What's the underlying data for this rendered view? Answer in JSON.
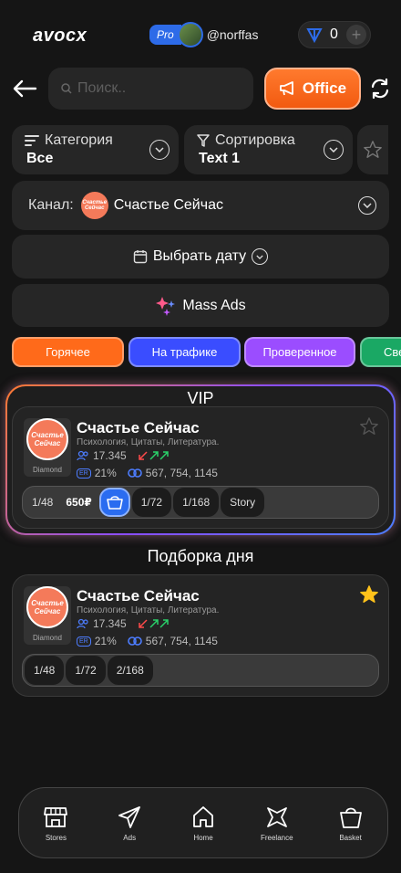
{
  "header": {
    "logo": "avocx",
    "pro_badge": "Pro",
    "username": "@norffas",
    "wallet_value": "0"
  },
  "search": {
    "placeholder": "Поиск.."
  },
  "office_label": "Office",
  "filters": {
    "category_label": "Категория",
    "category_value": "Все",
    "sort_label": "Сортировка",
    "sort_value": "Text 1"
  },
  "channel": {
    "label": "Канал:",
    "name": "Счастье Сейчас",
    "avatar_text": "Счастье Сейчас"
  },
  "date_button": "Выбрать дату",
  "mass_ads": "Mass Ads",
  "pills": [
    {
      "label": "Горячее",
      "color": "#ff6a1a"
    },
    {
      "label": "На трафике",
      "color": "#3a4dff"
    },
    {
      "label": "Проверенное",
      "color": "#9b4dff"
    },
    {
      "label": "Све",
      "color": "#1aa864"
    }
  ],
  "vip": {
    "title": "VIP",
    "card": {
      "name": "Счастье Сейчас",
      "tags": "Психология, Цитаты, Литература.",
      "subscribers": "17.345",
      "er": "21%",
      "reach": "567, 754, 1145",
      "badge": "Diamond",
      "avatar_text": "Счастье Сейчас",
      "slots": [
        "1/48",
        "650₽",
        "1/72",
        "1/168",
        "Story"
      ]
    }
  },
  "daily": {
    "title": "Подборка дня",
    "card": {
      "name": "Счастье Сейчас",
      "tags": "Психология, Цитаты, Литература.",
      "subscribers": "17.345",
      "er": "21%",
      "reach": "567, 754, 1145",
      "badge": "Diamond",
      "avatar_text": "Счастье Сейчас",
      "slots": [
        "1/48",
        "1/72",
        "2/168"
      ]
    }
  },
  "nav": {
    "stores": "Stores",
    "ads": "Ads",
    "home": "Home",
    "freelance": "Freelance",
    "basket": "Basket"
  }
}
